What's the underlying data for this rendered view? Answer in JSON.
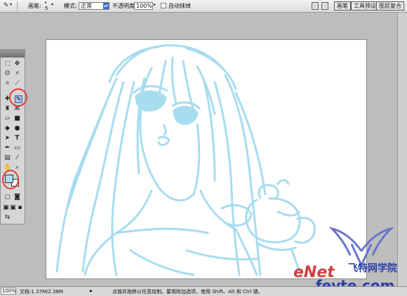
{
  "options_bar": {
    "brush_label": "画笔:",
    "brush_size": "5",
    "mode_label": "模式:",
    "mode_value": "正常",
    "opacity_label": "不透明度:",
    "opacity_value": "100%",
    "auto_erase_label": "自动抹掉",
    "tabs": [
      "画笔",
      "工具预设",
      "图层复合"
    ]
  },
  "status_bar": {
    "zoom": "100%",
    "doc_info": "文档:1.37M/2.38M",
    "hint": "点按并拖移以任意绘制。要用附加选项，使用 Shift、Alt 和 Ctrl 键。"
  },
  "colors": {
    "sketch": "#a8dcef",
    "highlight_ring": "#e23b3b",
    "foreground": "#a8dcef"
  },
  "watermark": {
    "logo_letters": "eNet",
    "site": "fevte.com",
    "brand": "飞特网学院"
  }
}
